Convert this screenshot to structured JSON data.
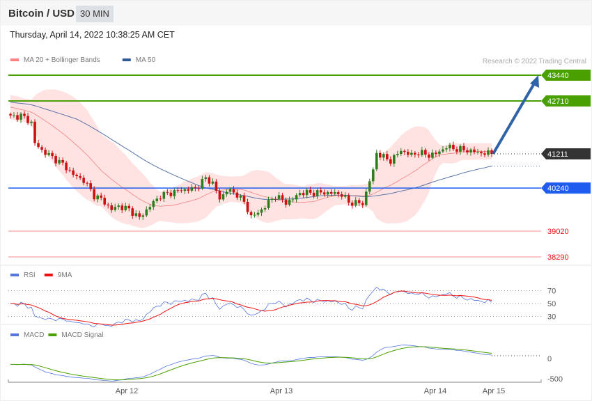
{
  "header": {
    "title": "Bitcoin / USD",
    "timeframe": "30 MIN",
    "datetime": "Thursday, April 14, 2022 10:38:25 AM CET"
  },
  "copyright": "Research © 2022 Trading Central",
  "colors": {
    "up": "#2e7d1e",
    "down": "#cc1111",
    "band": "#ffe3e3",
    "ma20": "#f08080",
    "ma50": "#5a73a8",
    "resistance": "#4aa000",
    "support": "#1e5cf0",
    "extra": "#f04040",
    "current": "#333333",
    "arrow": "#2f62a6",
    "rsi": "#5577dd",
    "rsi_ma": "#ee1111",
    "macd": "#5577dd",
    "signal": "#4aa000"
  },
  "chart_data": [
    {
      "type": "candlestick",
      "title": "Bitcoin / USD 30 MIN",
      "legend": [
        {
          "label": "MA 20 + Bollinger Bands",
          "color": "#ff8080"
        },
        {
          "label": "MA 50",
          "color": "#2f5a9a"
        }
      ],
      "ylim": [
        38290,
        43440
      ],
      "close_keypoints": [
        [
          0,
          42256
        ],
        [
          3,
          42296
        ],
        [
          6,
          42098
        ],
        [
          7,
          41506
        ],
        [
          9,
          41309
        ],
        [
          12,
          41112
        ],
        [
          15,
          40915
        ],
        [
          18,
          40619
        ],
        [
          21,
          40461
        ],
        [
          24,
          40027
        ],
        [
          26,
          39928
        ],
        [
          29,
          39632
        ],
        [
          31,
          39731
        ],
        [
          34,
          39632
        ],
        [
          37,
          39395
        ],
        [
          40,
          39731
        ],
        [
          43,
          40027
        ],
        [
          46,
          40106
        ],
        [
          49,
          40185
        ],
        [
          53,
          40224
        ],
        [
          56,
          40520
        ],
        [
          58,
          40382
        ],
        [
          60,
          39928
        ],
        [
          62,
          40185
        ],
        [
          65,
          40066
        ],
        [
          67,
          39829
        ],
        [
          69,
          39435
        ],
        [
          71,
          39533
        ],
        [
          73,
          39731
        ],
        [
          76,
          40027
        ],
        [
          79,
          39829
        ],
        [
          81,
          39928
        ],
        [
          83,
          40106
        ],
        [
          87,
          40106
        ],
        [
          91,
          40106
        ],
        [
          95,
          40066
        ],
        [
          97,
          39829
        ],
        [
          99,
          39829
        ],
        [
          101,
          39790
        ],
        [
          103,
          40461
        ],
        [
          104,
          40717
        ],
        [
          105,
          41250
        ],
        [
          107,
          41112
        ],
        [
          109,
          41013
        ],
        [
          112,
          41309
        ],
        [
          115,
          41171
        ],
        [
          117,
          41250
        ],
        [
          120,
          41171
        ],
        [
          122,
          41210
        ],
        [
          125,
          41408
        ],
        [
          128,
          41349
        ],
        [
          131,
          41309
        ],
        [
          134,
          41250
        ],
        [
          138,
          41211
        ]
      ],
      "levels": [
        {
          "value": 43440,
          "type": "resistance"
        },
        {
          "value": 42710,
          "type": "resistance"
        },
        {
          "value": 41211,
          "type": "current"
        },
        {
          "value": 40240,
          "type": "support"
        },
        {
          "value": 39020,
          "type": "extra"
        },
        {
          "value": 38290,
          "type": "extra"
        }
      ],
      "forecast_target": 43440,
      "level_labels": [
        "43440",
        "42710",
        "41211",
        "40240",
        "39020",
        "38290"
      ]
    },
    {
      "type": "line",
      "title": "RSI",
      "legend": [
        {
          "label": "RSI",
          "color": "#5577dd"
        },
        {
          "label": "9MA",
          "color": "#ee1111"
        }
      ],
      "ylim": [
        30,
        70
      ],
      "ticks": [
        "70",
        "50",
        "30"
      ]
    },
    {
      "type": "line",
      "title": "MACD",
      "legend": [
        {
          "label": "MACD",
          "color": "#5577dd"
        },
        {
          "label": "MACD Signal",
          "color": "#4aa000"
        }
      ],
      "ticks": [
        "0",
        "-500"
      ],
      "x_labels": [
        "Apr 12",
        "Apr 13",
        "Apr 14",
        "Apr 15"
      ]
    }
  ]
}
